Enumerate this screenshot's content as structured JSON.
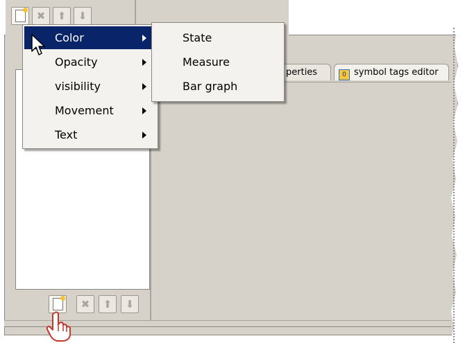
{
  "tabs": [
    {
      "label": "perties"
    },
    {
      "label": "symbol tags editor",
      "icon": "symbol-icon"
    }
  ],
  "context_menu": {
    "items": [
      {
        "label": "Color",
        "selected": true
      },
      {
        "label": "Opacity",
        "selected": false
      },
      {
        "label": "visibility",
        "selected": false
      },
      {
        "label": "Movement",
        "selected": false
      },
      {
        "label": "Text",
        "selected": false
      }
    ]
  },
  "submenu": {
    "items": [
      {
        "label": "State"
      },
      {
        "label": "Measure"
      },
      {
        "label": "Bar graph"
      }
    ]
  },
  "toolbar": {
    "buttons": [
      "new-icon",
      "delete-icon",
      "move-up-icon",
      "move-down-icon"
    ]
  },
  "colors": {
    "panel": "#d6d2ca",
    "menu": "#f4f2ee",
    "selection": "#0a246a"
  }
}
